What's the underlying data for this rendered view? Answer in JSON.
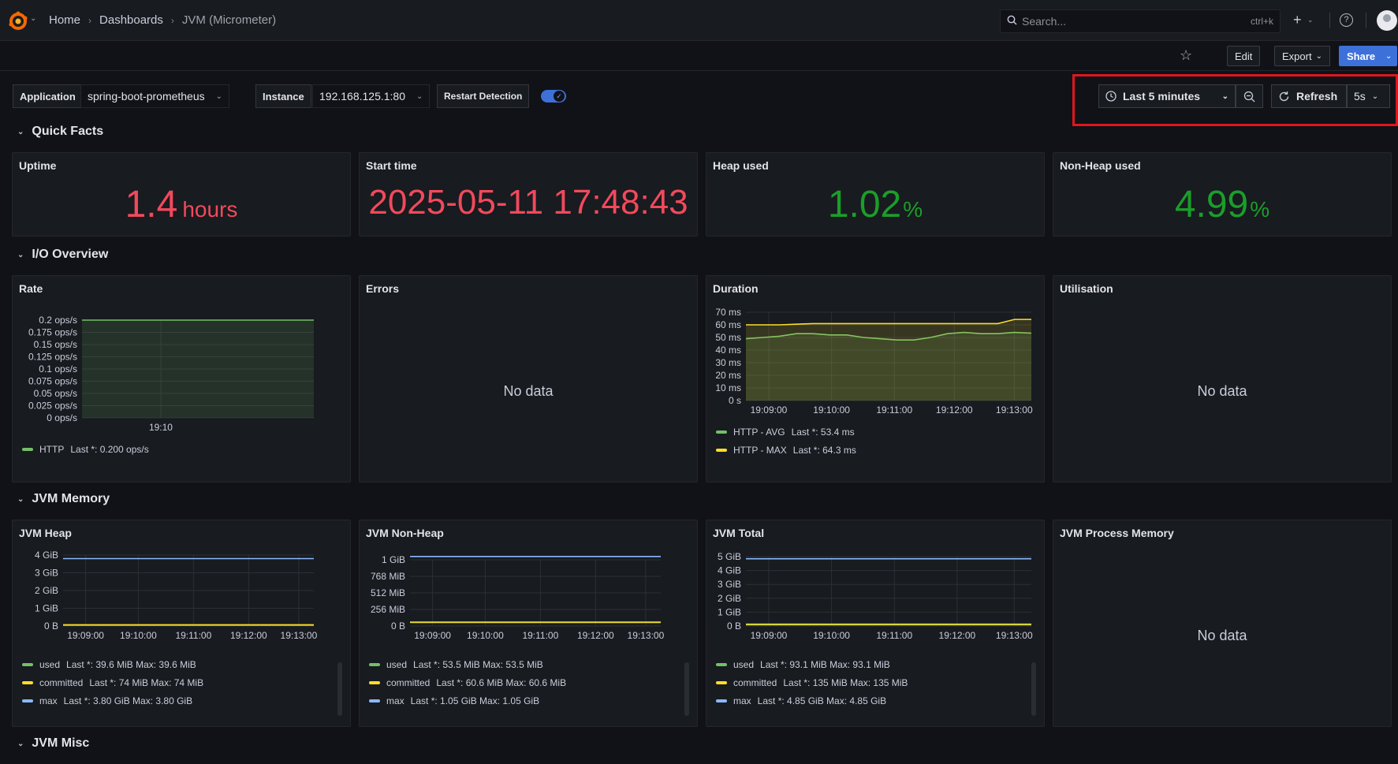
{
  "nav": {
    "breadcrumb": [
      "Home",
      "Dashboards",
      "JVM (Micrometer)"
    ],
    "search_placeholder": "Search...",
    "search_shortcut": "ctrl+k",
    "plus": "+"
  },
  "toolbar": {
    "edit": "Edit",
    "export": "Export",
    "share": "Share"
  },
  "variables": {
    "application_label": "Application",
    "application_value": "spring-boot-prometheus",
    "instance_label": "Instance",
    "instance_value": "192.168.125.1:80",
    "restart_label": "Restart Detection",
    "restart_enabled": true
  },
  "time_picker": {
    "range": "Last 5 minutes",
    "refresh": "Refresh",
    "interval": "5s"
  },
  "rows": {
    "quick_facts": "Quick Facts",
    "io_overview": "I/O Overview",
    "jvm_memory": "JVM Memory",
    "jvm_misc": "JVM Misc"
  },
  "stats": {
    "uptime": {
      "title": "Uptime",
      "value": "1.4",
      "unit": "hours",
      "color": "#f2495c"
    },
    "start_time": {
      "title": "Start time",
      "value": "2025-05-11 17:48:43",
      "color": "#f2495c"
    },
    "heap_used": {
      "title": "Heap used",
      "value": "1.02",
      "unit": "%",
      "color": "#1a9e2a"
    },
    "non_heap_used": {
      "title": "Non-Heap used",
      "value": "4.99",
      "unit": "%",
      "color": "#1a9e2a"
    }
  },
  "panels": {
    "rate": "Rate",
    "errors": "Errors",
    "duration": "Duration",
    "utilisation": "Utilisation",
    "jvm_heap": "JVM Heap",
    "jvm_non_heap": "JVM Non-Heap",
    "jvm_total": "JVM Total",
    "jvm_process_memory": "JVM Process Memory",
    "no_data": "No data"
  },
  "chart_data": [
    {
      "name": "Rate",
      "type": "line",
      "x_ticks": [
        "19:10"
      ],
      "y_ticks": [
        "0.2 ops/s",
        "0.175 ops/s",
        "0.15 ops/s",
        "0.125 ops/s",
        "0.1 ops/s",
        "0.075 ops/s",
        "0.05 ops/s",
        "0.025 ops/s",
        "0 ops/s"
      ],
      "ylim": [
        0,
        0.2
      ],
      "series": [
        {
          "name": "HTTP",
          "color": "#73bf69",
          "values": [
            0.2,
            0.2,
            0.2,
            0.2,
            0.2,
            0.2,
            0.2,
            0.2,
            0.2,
            0.2,
            0.2
          ],
          "legend": "Last *: 0.200 ops/s"
        }
      ]
    },
    {
      "name": "Duration",
      "type": "line",
      "x_ticks": [
        "19:09:00",
        "19:10:00",
        "19:11:00",
        "19:12:00",
        "19:13:00"
      ],
      "y_ticks": [
        "70 ms",
        "60 ms",
        "50 ms",
        "40 ms",
        "30 ms",
        "20 ms",
        "10 ms",
        "0 s"
      ],
      "ylim": [
        0,
        70
      ],
      "series": [
        {
          "name": "HTTP - AVG",
          "color": "#73bf69",
          "values": [
            49,
            50,
            51,
            53,
            53,
            52,
            52,
            50,
            49,
            48,
            48,
            50,
            53,
            54,
            53,
            53,
            54,
            53.4
          ],
          "legend": "Last *: 53.4 ms"
        },
        {
          "name": "HTTP - MAX",
          "color": "#fade2a",
          "values": [
            60,
            60,
            60,
            60.5,
            61,
            61,
            61,
            61,
            61,
            61,
            61,
            61,
            61,
            61,
            61,
            61,
            64.3,
            64.3
          ],
          "legend": "Last *: 64.3 ms"
        }
      ]
    },
    {
      "name": "JVM Heap",
      "type": "line",
      "x_ticks": [
        "19:09:00",
        "19:10:00",
        "19:11:00",
        "19:12:00",
        "19:13:00"
      ],
      "y_ticks": [
        "4 GiB",
        "3 GiB",
        "2 GiB",
        "1 GiB",
        "0 B"
      ],
      "ylim": [
        0,
        4
      ],
      "series": [
        {
          "name": "used",
          "color": "#73bf69",
          "values": [
            0.039,
            0.039
          ],
          "legend": "Last *: 39.6 MiB  Max: 39.6 MiB"
        },
        {
          "name": "committed",
          "color": "#fade2a",
          "values": [
            0.072,
            0.072
          ],
          "legend": "Last *: 74 MiB  Max: 74 MiB"
        },
        {
          "name": "max",
          "color": "#8ab8ff",
          "values": [
            3.8,
            3.8
          ],
          "legend": "Last *: 3.80 GiB  Max: 3.80 GiB"
        }
      ]
    },
    {
      "name": "JVM Non-Heap",
      "type": "line",
      "x_ticks": [
        "19:09:00",
        "19:10:00",
        "19:11:00",
        "19:12:00",
        "19:13:00"
      ],
      "y_ticks": [
        "1 GiB",
        "768 MiB",
        "512 MiB",
        "256 MiB",
        "0 B"
      ],
      "ylim": [
        0,
        1
      ],
      "series": [
        {
          "name": "used",
          "color": "#73bf69",
          "values": [
            0.052,
            0.052
          ],
          "legend": "Last *: 53.5 MiB  Max: 53.5 MiB"
        },
        {
          "name": "committed",
          "color": "#fade2a",
          "values": [
            0.059,
            0.059
          ],
          "legend": "Last *: 60.6 MiB  Max: 60.6 MiB"
        },
        {
          "name": "max",
          "color": "#8ab8ff",
          "values": [
            1.05,
            1.05
          ],
          "legend": "Last *: 1.05 GiB  Max: 1.05 GiB"
        }
      ]
    },
    {
      "name": "JVM Total",
      "type": "line",
      "x_ticks": [
        "19:09:00",
        "19:10:00",
        "19:11:00",
        "19:12:00",
        "19:13:00"
      ],
      "y_ticks": [
        "5 GiB",
        "4 GiB",
        "3 GiB",
        "2 GiB",
        "1 GiB",
        "0 B"
      ],
      "ylim": [
        0,
        5
      ],
      "series": [
        {
          "name": "used",
          "color": "#73bf69",
          "values": [
            0.091,
            0.091
          ],
          "legend": "Last *: 93.1 MiB  Max: 93.1 MiB"
        },
        {
          "name": "committed",
          "color": "#fade2a",
          "values": [
            0.132,
            0.132
          ],
          "legend": "Last *: 135 MiB  Max: 135 MiB"
        },
        {
          "name": "max",
          "color": "#8ab8ff",
          "values": [
            4.85,
            4.85
          ],
          "legend": "Last *: 4.85 GiB  Max: 4.85 GiB"
        }
      ]
    }
  ]
}
